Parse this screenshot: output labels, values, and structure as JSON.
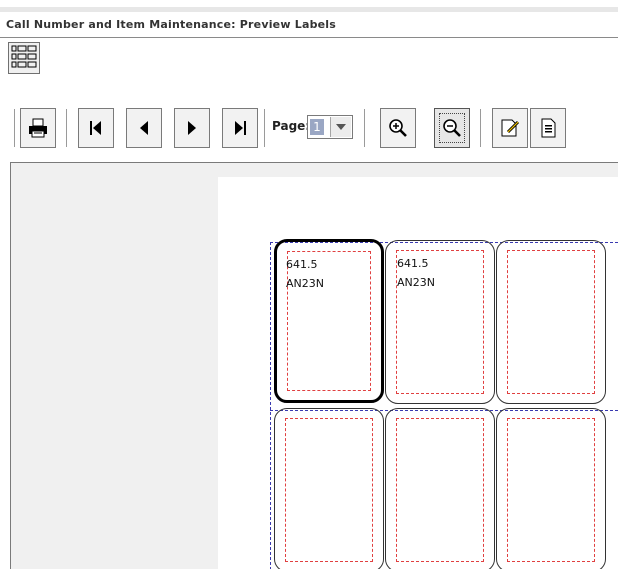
{
  "window": {
    "title": "Call Number and Item Maintenance: Preview Labels"
  },
  "toolbar": {
    "page_label": "Page:",
    "page_value": "1",
    "buttons": [
      "print-icon",
      "first-page-icon",
      "previous-page-icon",
      "next-page-icon",
      "last-page-icon",
      "zoom-in-icon",
      "zoom-out-icon",
      "edit-icon",
      "document-icon"
    ]
  },
  "labels": [
    {
      "call_number": "641.5",
      "cutter": "AN23N",
      "selected": true
    },
    {
      "call_number": "641.5",
      "cutter": "AN23N",
      "selected": false
    },
    {
      "call_number": "",
      "cutter": "",
      "selected": false
    },
    {
      "call_number": "",
      "cutter": "",
      "selected": false
    },
    {
      "call_number": "",
      "cutter": "",
      "selected": false
    },
    {
      "call_number": "",
      "cutter": "",
      "selected": false
    }
  ],
  "colors": {
    "cut_line": "#e04040",
    "guide_line": "#3a3ab0"
  }
}
